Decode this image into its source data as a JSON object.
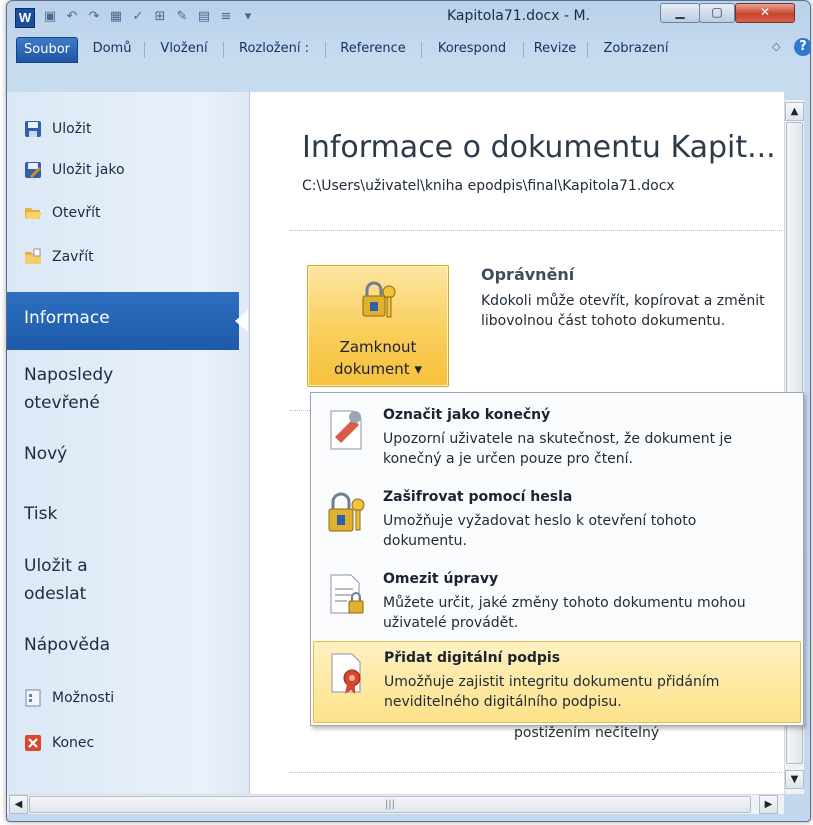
{
  "window": {
    "title": "Kapitola71.docx - M.",
    "app_icon": "W"
  },
  "ribbon": {
    "tabs": [
      {
        "label": "Soubor"
      },
      {
        "label": "Domů"
      },
      {
        "label": "Vložení"
      },
      {
        "label": "Rozložení :"
      },
      {
        "label": "Reference"
      },
      {
        "label": "Korespond"
      },
      {
        "label": "Revize"
      },
      {
        "label": "Zobrazení"
      }
    ],
    "help": "?"
  },
  "sidebar": {
    "commands": [
      {
        "label": "Uložit",
        "icon": "save-icon"
      },
      {
        "label": "Uložit jako",
        "icon": "save-as-icon"
      },
      {
        "label": "Otevřít",
        "icon": "open-folder-icon"
      },
      {
        "label": "Zavřít",
        "icon": "close-folder-icon"
      }
    ],
    "sections": [
      {
        "label": "Informace"
      },
      {
        "label": "Naposledy",
        "label2": "otevřené"
      },
      {
        "label": "Nový"
      },
      {
        "label": "Tisk"
      },
      {
        "label": "Uložit a",
        "label2": "odeslat"
      },
      {
        "label": "Nápověda"
      }
    ],
    "footer": [
      {
        "label": "Možnosti",
        "icon": "options-icon"
      },
      {
        "label": "Konec",
        "icon": "exit-icon"
      }
    ]
  },
  "main": {
    "title": "Informace o dokumentu Kapit...",
    "path": "C:\\Users\\uživatel\\kniha epodpis\\final\\Kapitola71.docx",
    "lock_button": {
      "line1": "Zamknout",
      "line2": "dokument ▾"
    },
    "permissions": {
      "title": "Oprávnění",
      "text": "Kdokoli může otevřít, kopírovat a změnit libovolnou část tohoto dokumentu."
    },
    "partial_text": "postižením nečitelný"
  },
  "dropdown": {
    "items": [
      {
        "title": "Označit jako konečný",
        "desc": "Upozorní uživatele na skutečnost, že dokument je konečný a je určen pouze pro čtení.",
        "icon": "mark-final-icon"
      },
      {
        "title": "Zašifrovat pomocí hesla",
        "desc": "Umožňuje vyžadovat heslo k otevření tohoto dokumentu.",
        "icon": "encrypt-lock-icon"
      },
      {
        "title": "Omezit úpravy",
        "desc": "Můžete určit, jaké změny tohoto dokumentu mohou uživatelé provádět.",
        "icon": "restrict-editing-icon"
      },
      {
        "title": "Přidat digitální podpis",
        "desc": "Umožňuje zajistit integritu dokumentu přidáním neviditelného digitálního podpisu.",
        "icon": "digital-signature-icon"
      }
    ]
  },
  "colors": {
    "active_tab": "#1f55a6",
    "nav_active": "#2d6fc0",
    "lock_button": "#f9ce5a",
    "menu_hover": "#fde28a"
  }
}
